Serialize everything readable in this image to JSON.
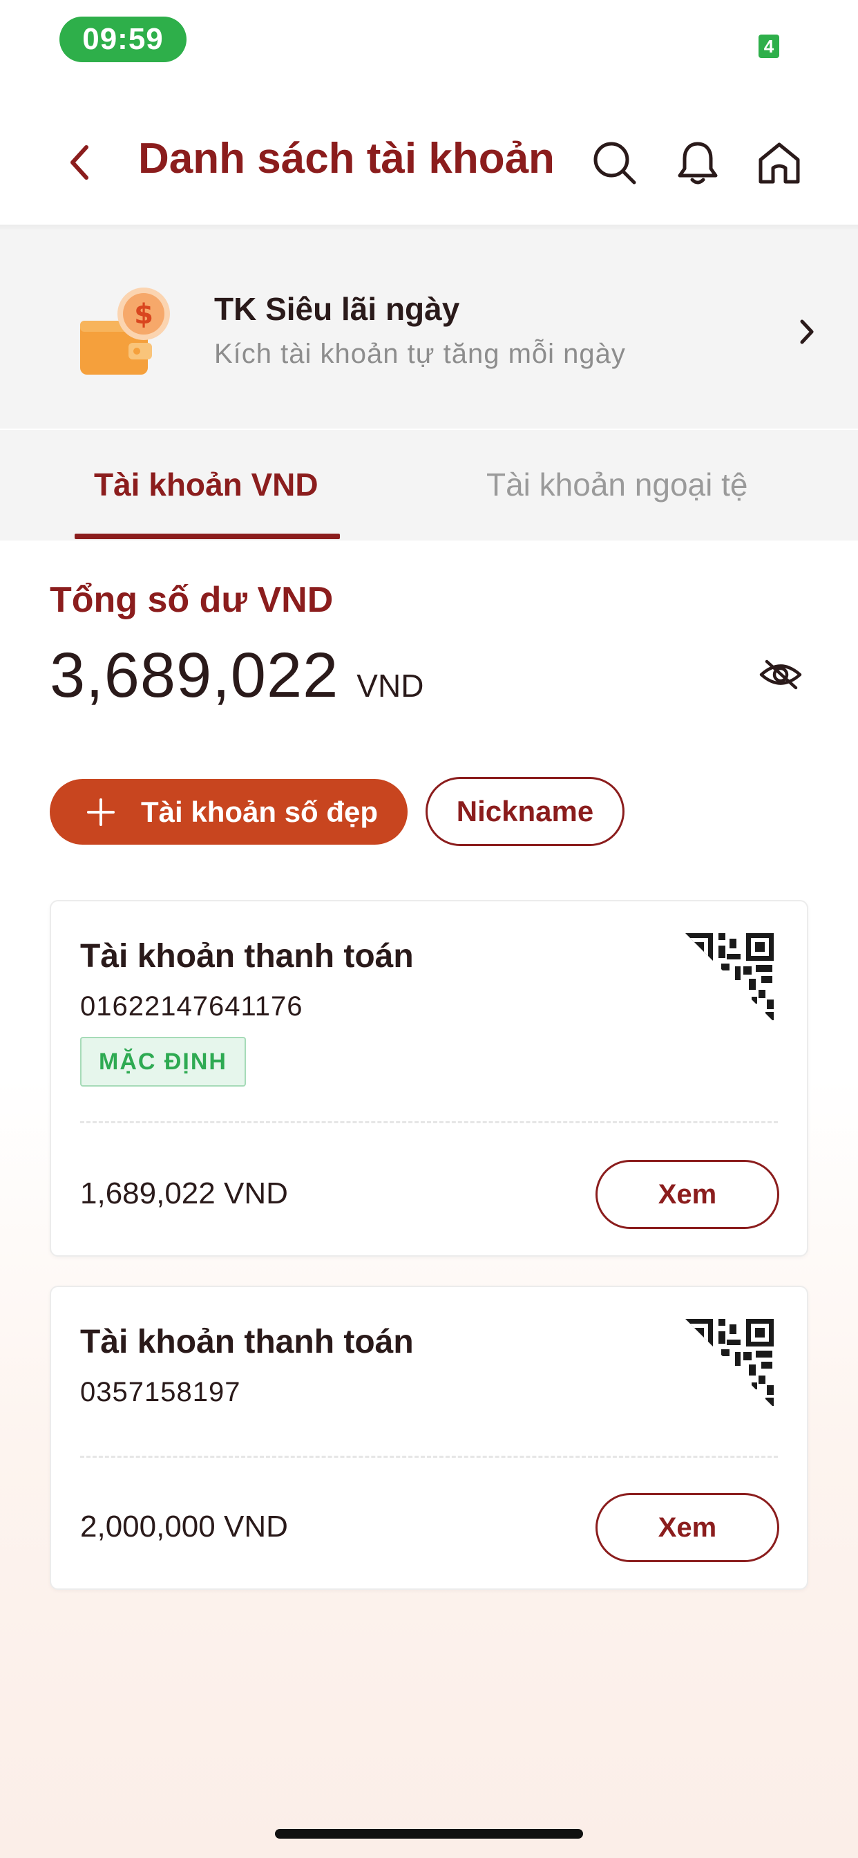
{
  "status_bar": {
    "time": "09:59",
    "network": "4"
  },
  "header": {
    "title": "Danh sách tài khoản"
  },
  "promo": {
    "title": "TK Siêu lãi ngày",
    "subtitle": "Kích tài khoản tự tăng mỗi ngày"
  },
  "tabs": [
    {
      "label": "Tài khoản VND",
      "active": true
    },
    {
      "label": "Tài khoản ngoại tệ",
      "active": false
    }
  ],
  "balance": {
    "label": "Tổng số dư VND",
    "amount": "3,689,022",
    "currency": "VND"
  },
  "actions": {
    "primary_label": "Tài khoản số đẹp",
    "nickname_label": "Nickname"
  },
  "accounts": [
    {
      "name": "Tài khoản thanh toán",
      "number": "01622147641176",
      "badge": "MẶC ĐỊNH",
      "balance": "1,689,022 VND",
      "view_label": "Xem"
    },
    {
      "name": "Tài khoản thanh toán",
      "number": "0357158197",
      "balance": "2,000,000 VND",
      "view_label": "Xem"
    }
  ],
  "colors": {
    "brand": "#8b1d1d",
    "accent": "#c8451f",
    "status_green": "#2eaf4a"
  }
}
